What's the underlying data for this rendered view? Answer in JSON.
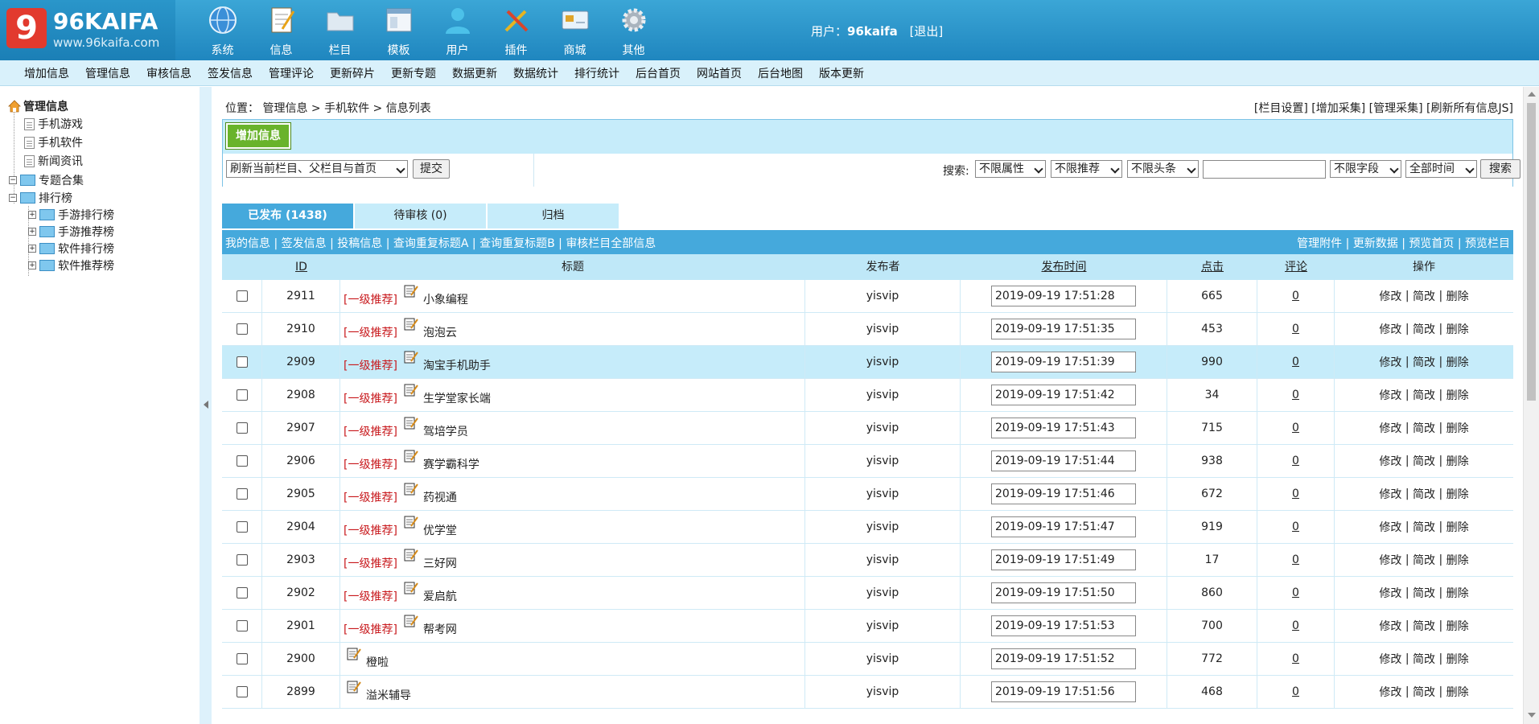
{
  "logo": {
    "mark": "9",
    "text": "96KAIFA",
    "sub": "www.96kaifa.com"
  },
  "topnav": [
    {
      "label": "系统",
      "icon": "globe-icon"
    },
    {
      "label": "信息",
      "icon": "notepad-icon"
    },
    {
      "label": "栏目",
      "icon": "folder-icon"
    },
    {
      "label": "模板",
      "icon": "window-icon"
    },
    {
      "label": "用户",
      "icon": "user-icon"
    },
    {
      "label": "插件",
      "icon": "tools-icon"
    },
    {
      "label": "商城",
      "icon": "card-icon"
    },
    {
      "label": "其他",
      "icon": "gear-icon"
    }
  ],
  "user": {
    "prefix": "用户：",
    "name": "96kaifa",
    "logout": "[退出]"
  },
  "submenu": [
    "增加信息",
    "管理信息",
    "审核信息",
    "签发信息",
    "管理评论",
    "更新碎片",
    "更新专题",
    "数据更新",
    "数据统计",
    "排行统计",
    "后台首页",
    "网站首页",
    "后台地图",
    "版本更新"
  ],
  "sidebar": {
    "root": "管理信息",
    "docs": [
      "手机游戏",
      "手机软件",
      "新闻资讯"
    ],
    "folders": [
      "专题合集",
      "排行榜"
    ],
    "sub": [
      "手游排行榜",
      "手游推荐榜",
      "软件排行榜",
      "软件推荐榜"
    ]
  },
  "breadcrumb": {
    "prefix": "位置：",
    "path": "管理信息 > 手机软件 > 信息列表"
  },
  "toplinks": [
    "[栏目设置]",
    "[增加采集]",
    "[管理采集]",
    "[刷新所有信息JS]"
  ],
  "panel": {
    "add_label": "增加信息",
    "refresh_select": "刷新当前栏目、父栏目与首页",
    "submit": "提交",
    "search_label": "搜索:",
    "filters": [
      "不限属性",
      "不限推荐",
      "不限头条"
    ],
    "search_value": "",
    "field": "不限字段",
    "time": "全部时间",
    "search_btn": "搜索"
  },
  "tabs": [
    "已发布 (1438)",
    "待审核 (0)",
    "归档"
  ],
  "actionbar": {
    "left": [
      "我的信息",
      "签发信息",
      "投稿信息",
      "查询重复标题A",
      "查询重复标题B",
      "审核栏目全部信息"
    ],
    "right": [
      "管理附件",
      "更新数据",
      "预览首页",
      "预览栏目"
    ]
  },
  "table": {
    "headers": {
      "id": "ID",
      "title": "标题",
      "publisher": "发布者",
      "time": "发布时间",
      "hits": "点击",
      "comments": "评论",
      "ops": "操作"
    },
    "ops": [
      "修改",
      "简改",
      "删除"
    ],
    "rows": [
      {
        "id": "2911",
        "rec": "[一级推荐]",
        "title": "小象编程",
        "publisher": "yisvip",
        "time": "2019-09-19 17:51:28",
        "hits": "665",
        "comments": "0"
      },
      {
        "id": "2910",
        "rec": "[一级推荐]",
        "title": "泡泡云",
        "publisher": "yisvip",
        "time": "2019-09-19 17:51:35",
        "hits": "453",
        "comments": "0"
      },
      {
        "id": "2909",
        "rec": "[一级推荐]",
        "title": "淘宝手机助手",
        "publisher": "yisvip",
        "time": "2019-09-19 17:51:39",
        "hits": "990",
        "comments": "0"
      },
      {
        "id": "2908",
        "rec": "[一级推荐]",
        "title": "生学堂家长端",
        "publisher": "yisvip",
        "time": "2019-09-19 17:51:42",
        "hits": "34",
        "comments": "0"
      },
      {
        "id": "2907",
        "rec": "[一级推荐]",
        "title": "驾培学员",
        "publisher": "yisvip",
        "time": "2019-09-19 17:51:43",
        "hits": "715",
        "comments": "0"
      },
      {
        "id": "2906",
        "rec": "[一级推荐]",
        "title": "赛学霸科学",
        "publisher": "yisvip",
        "time": "2019-09-19 17:51:44",
        "hits": "938",
        "comments": "0"
      },
      {
        "id": "2905",
        "rec": "[一级推荐]",
        "title": "药视通",
        "publisher": "yisvip",
        "time": "2019-09-19 17:51:46",
        "hits": "672",
        "comments": "0"
      },
      {
        "id": "2904",
        "rec": "[一级推荐]",
        "title": "优学堂",
        "publisher": "yisvip",
        "time": "2019-09-19 17:51:47",
        "hits": "919",
        "comments": "0"
      },
      {
        "id": "2903",
        "rec": "[一级推荐]",
        "title": "三好网",
        "publisher": "yisvip",
        "time": "2019-09-19 17:51:49",
        "hits": "17",
        "comments": "0"
      },
      {
        "id": "2902",
        "rec": "[一级推荐]",
        "title": "爱启航",
        "publisher": "yisvip",
        "time": "2019-09-19 17:51:50",
        "hits": "860",
        "comments": "0"
      },
      {
        "id": "2901",
        "rec": "[一级推荐]",
        "title": "帮考网",
        "publisher": "yisvip",
        "time": "2019-09-19 17:51:53",
        "hits": "700",
        "comments": "0"
      },
      {
        "id": "2900",
        "rec": "",
        "title": "橙啦",
        "publisher": "yisvip",
        "time": "2019-09-19 17:51:52",
        "hits": "772",
        "comments": "0"
      },
      {
        "id": "2899",
        "rec": "",
        "title": "溢米辅导",
        "publisher": "yisvip",
        "time": "2019-09-19 17:51:56",
        "hits": "468",
        "comments": "0"
      }
    ]
  },
  "colors": {
    "header": "#2a96ca",
    "accent": "#45a9dc",
    "light": "#c6ecfa",
    "recommend": "#c8191d",
    "add_btn": "#69b32b"
  }
}
